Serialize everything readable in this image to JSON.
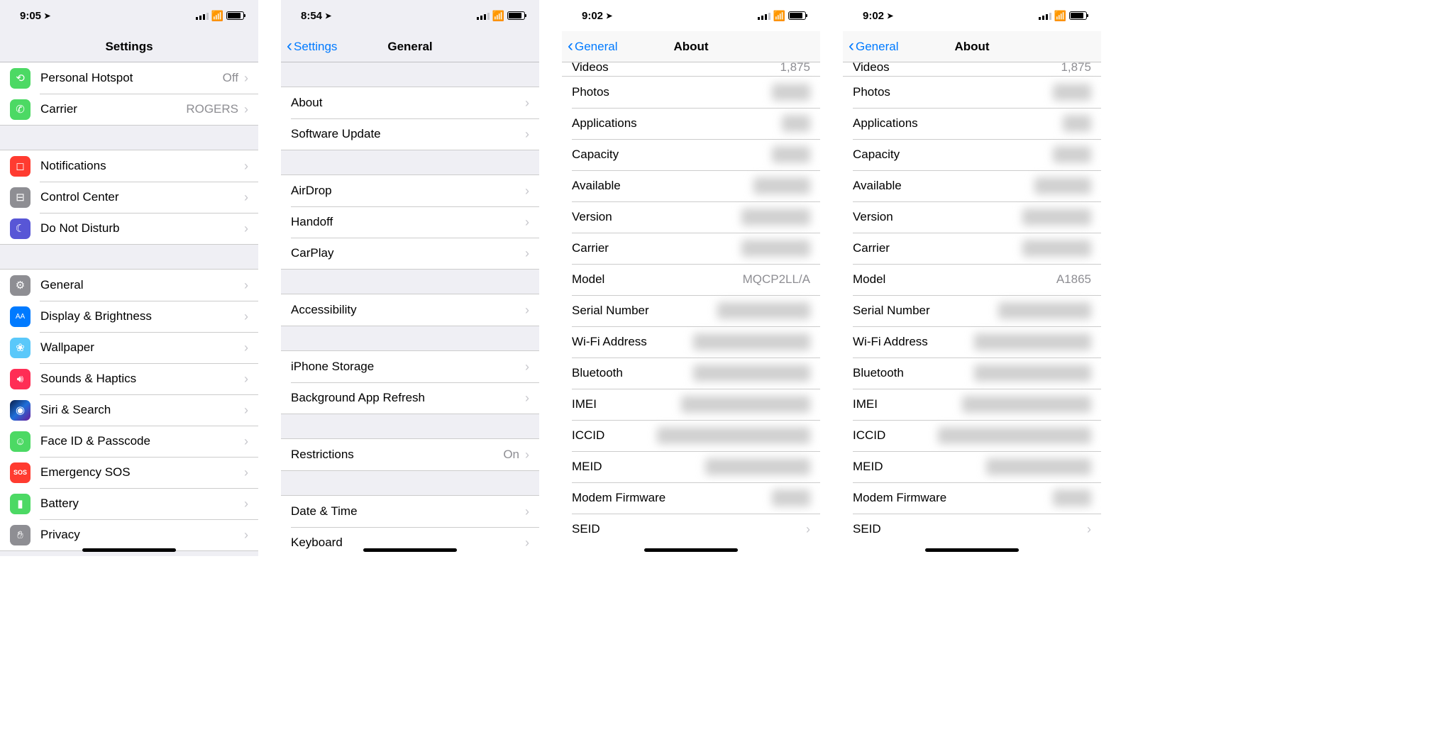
{
  "screen1": {
    "time": "9:05",
    "title": "Settings",
    "rows": {
      "hotspot": {
        "label": "Personal Hotspot",
        "value": "Off"
      },
      "carrier": {
        "label": "Carrier",
        "value": "ROGERS"
      },
      "notif": {
        "label": "Notifications"
      },
      "cc": {
        "label": "Control Center"
      },
      "dnd": {
        "label": "Do Not Disturb"
      },
      "general": {
        "label": "General"
      },
      "display": {
        "label": "Display & Brightness"
      },
      "wall": {
        "label": "Wallpaper"
      },
      "sound": {
        "label": "Sounds & Haptics"
      },
      "siri": {
        "label": "Siri & Search"
      },
      "face": {
        "label": "Face ID & Passcode"
      },
      "sos": {
        "label": "Emergency SOS"
      },
      "batt": {
        "label": "Battery"
      },
      "priv": {
        "label": "Privacy"
      }
    }
  },
  "screen2": {
    "time": "8:54",
    "back": "Settings",
    "title": "General",
    "rows": {
      "about": {
        "label": "About"
      },
      "update": {
        "label": "Software Update"
      },
      "airdrop": {
        "label": "AirDrop"
      },
      "handoff": {
        "label": "Handoff"
      },
      "carplay": {
        "label": "CarPlay"
      },
      "access": {
        "label": "Accessibility"
      },
      "storage": {
        "label": "iPhone Storage"
      },
      "bgapp": {
        "label": "Background App Refresh"
      },
      "restrict": {
        "label": "Restrictions",
        "value": "On"
      },
      "date": {
        "label": "Date & Time"
      },
      "keyboard": {
        "label": "Keyboard"
      }
    }
  },
  "screen3": {
    "time": "9:02",
    "back": "General",
    "title": "About",
    "partial": {
      "label": "Videos",
      "value": "1,875"
    },
    "rows": {
      "photos": {
        "label": "Photos"
      },
      "apps": {
        "label": "Applications"
      },
      "cap": {
        "label": "Capacity"
      },
      "avail": {
        "label": "Available"
      },
      "ver": {
        "label": "Version"
      },
      "carrier": {
        "label": "Carrier"
      },
      "model": {
        "label": "Model",
        "value": "MQCP2LL/A"
      },
      "serial": {
        "label": "Serial Number"
      },
      "wifi": {
        "label": "Wi-Fi Address"
      },
      "bt": {
        "label": "Bluetooth"
      },
      "imei": {
        "label": "IMEI"
      },
      "iccid": {
        "label": "ICCID"
      },
      "meid": {
        "label": "MEID"
      },
      "modem": {
        "label": "Modem Firmware"
      },
      "seid": {
        "label": "SEID"
      }
    }
  },
  "screen4": {
    "time": "9:02",
    "back": "General",
    "title": "About",
    "partial": {
      "label": "Videos",
      "value": "1,875"
    },
    "rows": {
      "photos": {
        "label": "Photos"
      },
      "apps": {
        "label": "Applications"
      },
      "cap": {
        "label": "Capacity"
      },
      "avail": {
        "label": "Available"
      },
      "ver": {
        "label": "Version"
      },
      "carrier": {
        "label": "Carrier"
      },
      "model": {
        "label": "Model",
        "value": "A1865"
      },
      "serial": {
        "label": "Serial Number"
      },
      "wifi": {
        "label": "Wi-Fi Address"
      },
      "bt": {
        "label": "Bluetooth"
      },
      "imei": {
        "label": "IMEI"
      },
      "iccid": {
        "label": "ICCID"
      },
      "meid": {
        "label": "MEID"
      },
      "modem": {
        "label": "Modem Firmware"
      },
      "seid": {
        "label": "SEID"
      }
    }
  }
}
